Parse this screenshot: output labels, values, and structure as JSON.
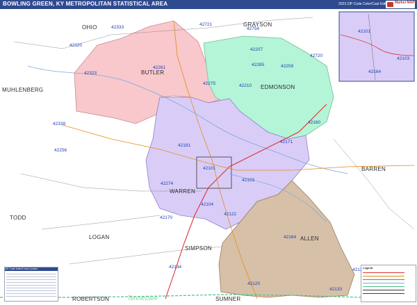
{
  "header": {
    "title": "BOWLING GREEN, KY METROPOLITAN STATISTICAL AREA",
    "edition": "2023 ZIP Code Color/Cast Edition",
    "brand": "Market MAPS"
  },
  "colors": {
    "butler": "#f8c8cc",
    "edmonson": "#b3f5d6",
    "warren": "#d9cdf7",
    "allen": "#d7c0a8",
    "title_bar": "#2f4a8f",
    "zip_text": "#1a3fb5"
  },
  "counties": [
    {
      "name": "OHIO"
    },
    {
      "name": "GRAYSON"
    },
    {
      "name": "BUTLER"
    },
    {
      "name": "EDMONSON"
    },
    {
      "name": "MUHLENBERG"
    },
    {
      "name": "BARREN"
    },
    {
      "name": "WARREN"
    },
    {
      "name": "TODD"
    },
    {
      "name": "LOGAN"
    },
    {
      "name": "ALLEN"
    },
    {
      "name": "SIMPSON"
    },
    {
      "name": "ROBERTSON"
    },
    {
      "name": "SUMNER"
    }
  ],
  "states": [
    {
      "name": "Tennessee"
    }
  ],
  "zips": [
    {
      "code": "42333"
    },
    {
      "code": "42721"
    },
    {
      "code": "42754"
    },
    {
      "code": "42320"
    },
    {
      "code": "42207"
    },
    {
      "code": "42720"
    },
    {
      "code": "42285"
    },
    {
      "code": "42259"
    },
    {
      "code": "42261"
    },
    {
      "code": "42323"
    },
    {
      "code": "42275"
    },
    {
      "code": "42210"
    },
    {
      "code": "42339"
    },
    {
      "code": "42160"
    },
    {
      "code": "42256"
    },
    {
      "code": "42171"
    },
    {
      "code": "42181"
    },
    {
      "code": "42101"
    },
    {
      "code": "42103"
    },
    {
      "code": "42274"
    },
    {
      "code": "42104"
    },
    {
      "code": "42122"
    },
    {
      "code": "42170"
    },
    {
      "code": "42164"
    },
    {
      "code": "42134"
    },
    {
      "code": "42123"
    },
    {
      "code": "42120"
    },
    {
      "code": "42133"
    },
    {
      "code": "42101"
    },
    {
      "code": "42103"
    },
    {
      "code": "42164"
    }
  ],
  "inset": {
    "zips": [
      "42101",
      "42103",
      "42164"
    ]
  },
  "legend": {
    "title": "Legend"
  },
  "ziptable": {
    "title": "ZIP Code Index/Cross Locator"
  }
}
